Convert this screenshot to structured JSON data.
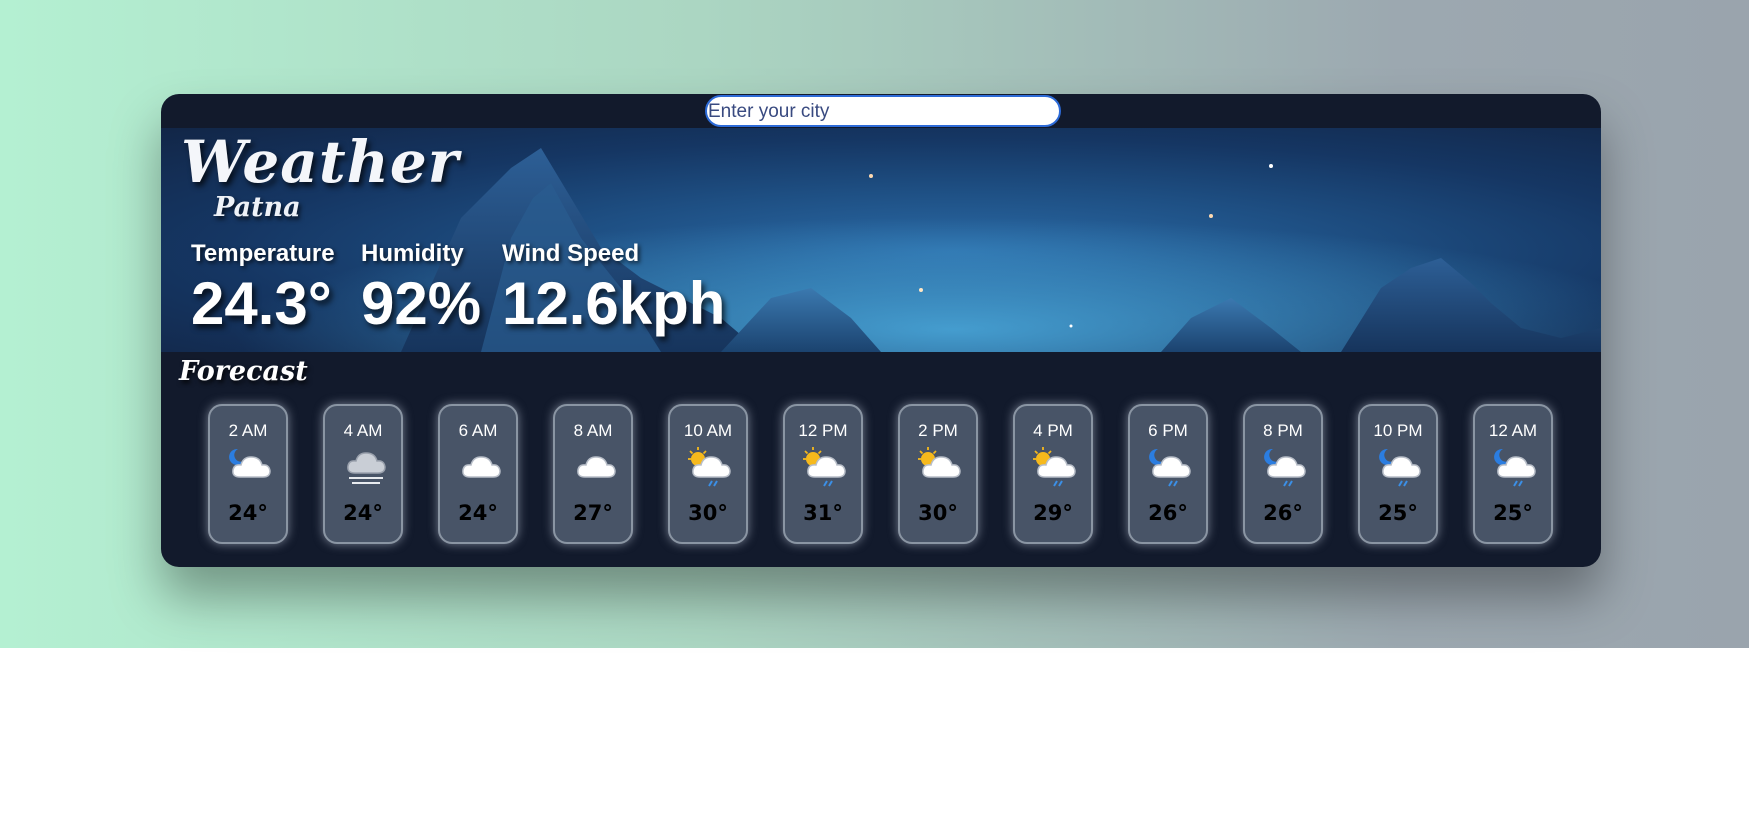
{
  "search": {
    "placeholder": "Enter your city"
  },
  "current": {
    "title": "Weather",
    "city": "Patna",
    "temperature": {
      "label": "Temperature",
      "value": "24.3°"
    },
    "humidity": {
      "label": "Humidity",
      "value": "92%"
    },
    "wind": {
      "label": "Wind Speed",
      "value": "12.6kph"
    }
  },
  "forecast": {
    "title": "Forecast",
    "hours": [
      {
        "time": "2 AM",
        "temp": "24°",
        "icon": "night-cloudy-icon"
      },
      {
        "time": "4 AM",
        "temp": "24°",
        "icon": "fog-cloud-icon"
      },
      {
        "time": "6 AM",
        "temp": "24°",
        "icon": "cloud-icon"
      },
      {
        "time": "8 AM",
        "temp": "27°",
        "icon": "cloud-icon"
      },
      {
        "time": "10 AM",
        "temp": "30°",
        "icon": "sun-rain-cloud-icon"
      },
      {
        "time": "12 PM",
        "temp": "31°",
        "icon": "sun-rain-cloud-icon"
      },
      {
        "time": "2 PM",
        "temp": "30°",
        "icon": "sun-cloud-icon"
      },
      {
        "time": "4 PM",
        "temp": "29°",
        "icon": "sun-rain-cloud-icon"
      },
      {
        "time": "6 PM",
        "temp": "26°",
        "icon": "night-rain-cloud-icon"
      },
      {
        "time": "8 PM",
        "temp": "26°",
        "icon": "night-rain-cloud-icon"
      },
      {
        "time": "10 PM",
        "temp": "25°",
        "icon": "night-rain-cloud-icon"
      },
      {
        "time": "12 AM",
        "temp": "25°",
        "icon": "night-rain-cloud-icon"
      }
    ]
  },
  "colors": {
    "card": "#121a2c",
    "forecast_card": "#485467",
    "search_border": "#2d6bd8"
  }
}
